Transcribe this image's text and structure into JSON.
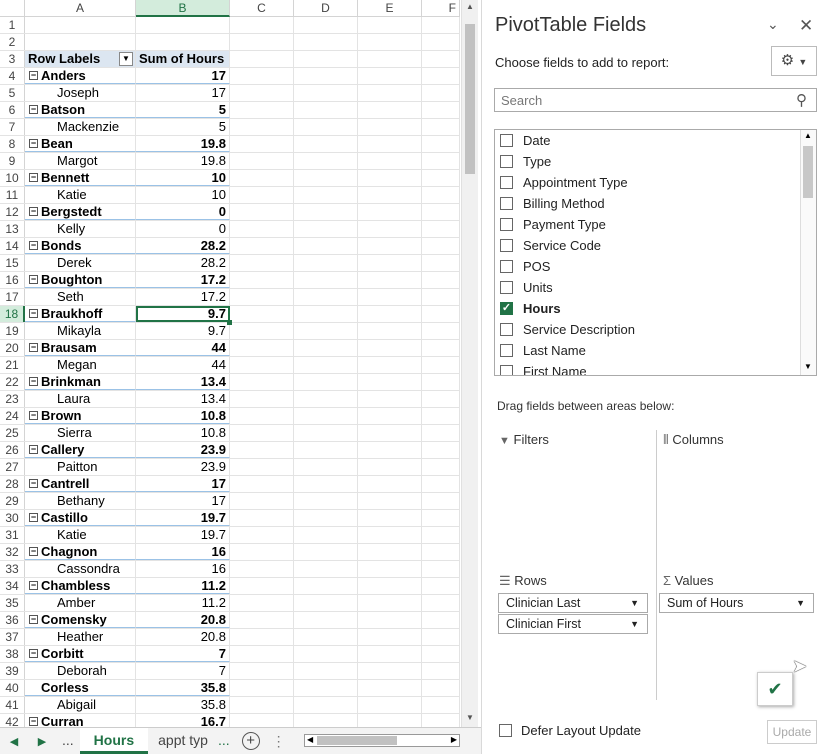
{
  "sheet": {
    "columns": [
      "A",
      "B",
      "C",
      "D",
      "E",
      "F"
    ],
    "header": {
      "row_labels": "Row Labels",
      "sum_hours": "Sum of Hours"
    },
    "rows": [
      {
        "n": "1",
        "type": "empty"
      },
      {
        "n": "2",
        "type": "empty"
      },
      {
        "n": "3",
        "type": "header"
      },
      {
        "n": "4",
        "type": "group",
        "label": "Anders",
        "value": "17"
      },
      {
        "n": "5",
        "type": "item",
        "label": "Joseph",
        "value": "17"
      },
      {
        "n": "6",
        "type": "group",
        "label": "Batson",
        "value": "5"
      },
      {
        "n": "7",
        "type": "item",
        "label": "Mackenzie",
        "value": "5"
      },
      {
        "n": "8",
        "type": "group",
        "label": "Bean",
        "value": "19.8"
      },
      {
        "n": "9",
        "type": "item",
        "label": "Margot",
        "value": "19.8"
      },
      {
        "n": "10",
        "type": "group",
        "label": "Bennett",
        "value": "10"
      },
      {
        "n": "11",
        "type": "item",
        "label": "Katie",
        "value": "10"
      },
      {
        "n": "12",
        "type": "group",
        "label": "Bergstedt",
        "value": "0"
      },
      {
        "n": "13",
        "type": "item",
        "label": "Kelly",
        "value": "0"
      },
      {
        "n": "14",
        "type": "group",
        "label": "Bonds",
        "value": "28.2"
      },
      {
        "n": "15",
        "type": "item",
        "label": "Derek",
        "value": "28.2"
      },
      {
        "n": "16",
        "type": "group",
        "label": "Boughton",
        "value": "17.2"
      },
      {
        "n": "17",
        "type": "item",
        "label": "Seth",
        "value": "17.2"
      },
      {
        "n": "18",
        "type": "group",
        "label": "Braukhoff",
        "value": "9.7",
        "selected": true
      },
      {
        "n": "19",
        "type": "item",
        "label": "Mikayla",
        "value": "9.7"
      },
      {
        "n": "20",
        "type": "group",
        "label": "Brausam",
        "value": "44"
      },
      {
        "n": "21",
        "type": "item",
        "label": "Megan",
        "value": "44"
      },
      {
        "n": "22",
        "type": "group",
        "label": "Brinkman",
        "value": "13.4"
      },
      {
        "n": "23",
        "type": "item",
        "label": "Laura",
        "value": "13.4"
      },
      {
        "n": "24",
        "type": "group",
        "label": "Brown",
        "value": "10.8"
      },
      {
        "n": "25",
        "type": "item",
        "label": "Sierra",
        "value": "10.8"
      },
      {
        "n": "26",
        "type": "group",
        "label": "Callery",
        "value": "23.9"
      },
      {
        "n": "27",
        "type": "item",
        "label": "Paitton",
        "value": "23.9"
      },
      {
        "n": "28",
        "type": "group",
        "label": "Cantrell",
        "value": "17"
      },
      {
        "n": "29",
        "type": "item",
        "label": "Bethany",
        "value": "17"
      },
      {
        "n": "30",
        "type": "group",
        "label": "Castillo",
        "value": "19.7"
      },
      {
        "n": "31",
        "type": "item",
        "label": "Katie",
        "value": "19.7"
      },
      {
        "n": "32",
        "type": "group",
        "label": "Chagnon",
        "value": "16"
      },
      {
        "n": "33",
        "type": "item",
        "label": "Cassondra",
        "value": "16"
      },
      {
        "n": "34",
        "type": "group",
        "label": "Chambless",
        "value": "11.2"
      },
      {
        "n": "35",
        "type": "item",
        "label": "Amber",
        "value": "11.2"
      },
      {
        "n": "36",
        "type": "group",
        "label": "Comensky",
        "value": "20.8"
      },
      {
        "n": "37",
        "type": "item",
        "label": "Heather",
        "value": "20.8"
      },
      {
        "n": "38",
        "type": "group",
        "label": "Corbitt",
        "value": "7"
      },
      {
        "n": "39",
        "type": "item",
        "label": "Deborah",
        "value": "7"
      },
      {
        "n": "40",
        "type": "group",
        "label": "Corless",
        "value": "35.8",
        "nobox": true
      },
      {
        "n": "41",
        "type": "item",
        "label": "Abigail",
        "value": "35.8"
      },
      {
        "n": "42",
        "type": "group",
        "label": "Curran",
        "value": "16.7"
      }
    ],
    "tabs": {
      "ellipsis_left": "...",
      "active": "Hours",
      "next": "appt typ",
      "ellipsis_right": "..."
    }
  },
  "pane": {
    "title": "PivotTable Fields",
    "choose": "Choose fields to add to report:",
    "search_placeholder": "Search",
    "fields": [
      {
        "label": "Date",
        "checked": false
      },
      {
        "label": "Type",
        "checked": false
      },
      {
        "label": "Appointment Type",
        "checked": false
      },
      {
        "label": "Billing Method",
        "checked": false
      },
      {
        "label": "Payment Type",
        "checked": false
      },
      {
        "label": "Service Code",
        "checked": false
      },
      {
        "label": "POS",
        "checked": false
      },
      {
        "label": "Units",
        "checked": false
      },
      {
        "label": "Hours",
        "checked": true
      },
      {
        "label": "Service Description",
        "checked": false
      },
      {
        "label": "Last Name",
        "checked": false
      },
      {
        "label": "First Name",
        "checked": false
      }
    ],
    "drag_text": "Drag fields between areas below:",
    "filters": "Filters",
    "columns": "Columns",
    "rows": "Rows",
    "values": "Values",
    "row_fields": [
      "Clinician Last",
      "Clinician First"
    ],
    "value_fields": [
      "Sum of Hours"
    ],
    "defer": "Defer Layout Update",
    "update": "Update"
  }
}
